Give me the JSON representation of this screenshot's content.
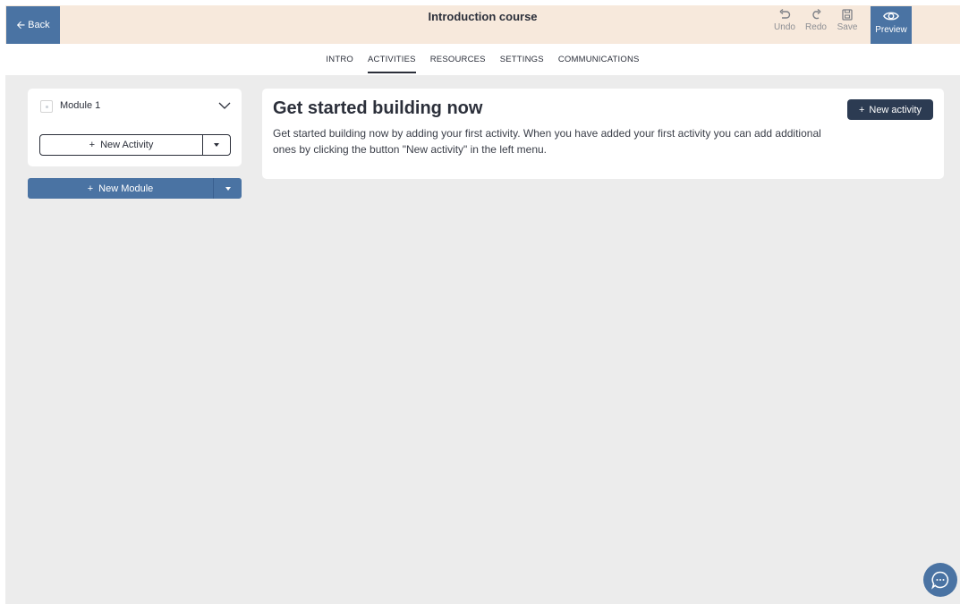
{
  "colors": {
    "topbar_bg": "#f7e9dc",
    "accent_blue": "#4a73a3",
    "dark_navy": "#2c3b52",
    "canvas_bg": "#ececec"
  },
  "topbar": {
    "back_label": "Back",
    "back_icon": "arrow-left-icon",
    "title": "Introduction course",
    "undo_label": "Undo",
    "redo_label": "Redo",
    "save_label": "Save",
    "preview_label": "Preview"
  },
  "tabs": [
    {
      "label": "INTRO",
      "active": false
    },
    {
      "label": "ACTIVITIES",
      "active": true
    },
    {
      "label": "RESOURCES",
      "active": false
    },
    {
      "label": "SETTINGS",
      "active": false
    },
    {
      "label": "COMMUNICATIONS",
      "active": false
    }
  ],
  "sidebar": {
    "module": {
      "name": "Module 1",
      "new_activity_label": "New Activity"
    },
    "new_module_label": "New Module"
  },
  "main": {
    "heading": "Get started building now",
    "description": "Get started building now by adding your first activity. When you have added your first activity you can add additional ones by clicking the button \"New activity\" in the left menu.",
    "new_activity_label": "New activity"
  },
  "chat": {
    "icon": "chat-bubble-icon"
  }
}
